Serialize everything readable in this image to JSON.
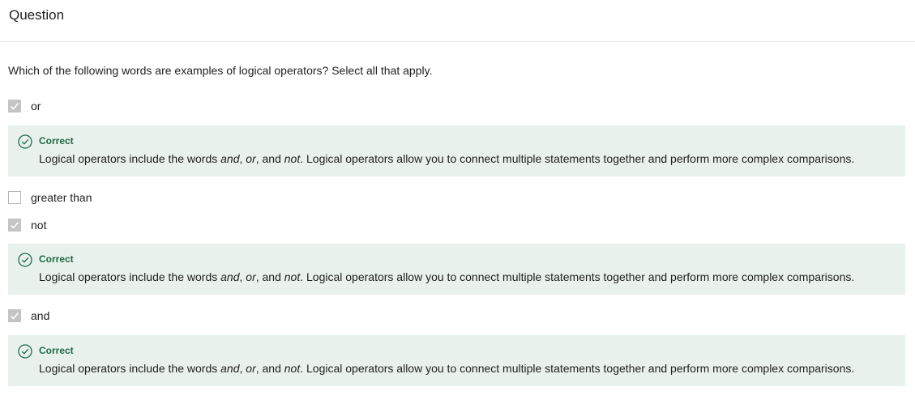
{
  "header": {
    "title": "Question"
  },
  "question": {
    "prompt": "Which of the following words are examples of logical operators? Select all that apply."
  },
  "options": [
    {
      "label": "or",
      "checked": true
    },
    {
      "label": "greater than",
      "checked": false
    },
    {
      "label": "not",
      "checked": true
    },
    {
      "label": "and",
      "checked": true
    }
  ],
  "feedback": [
    {
      "status": "Correct",
      "text_before": "Logical operators include the words ",
      "w1": "and",
      "sep1": ", ",
      "w2": "or",
      "sep2": ", and ",
      "w3": "not",
      "text_after": ". Logical operators allow you to connect multiple statements together and perform more complex comparisons."
    },
    {
      "status": "Correct",
      "text_before": "Logical operators include the words ",
      "w1": "and",
      "sep1": ", ",
      "w2": "or",
      "sep2": ", and ",
      "w3": "not",
      "text_after": ". Logical operators allow you to connect multiple statements together and perform more complex comparisons."
    },
    {
      "status": "Correct",
      "text_before": "Logical operators include the words ",
      "w1": "and",
      "sep1": ", ",
      "w2": "or",
      "sep2": ", and ",
      "w3": "not",
      "text_after": ". Logical operators allow you to connect multiple statements together and perform more complex comparisons."
    }
  ],
  "colors": {
    "feedback_bg": "#e8f1ec",
    "correct_green": "#1f6a45",
    "checkbox_checked": "#c4c4c4"
  },
  "icons": {
    "correct": "check-circle-icon",
    "checkmark": "checkmark-icon"
  }
}
